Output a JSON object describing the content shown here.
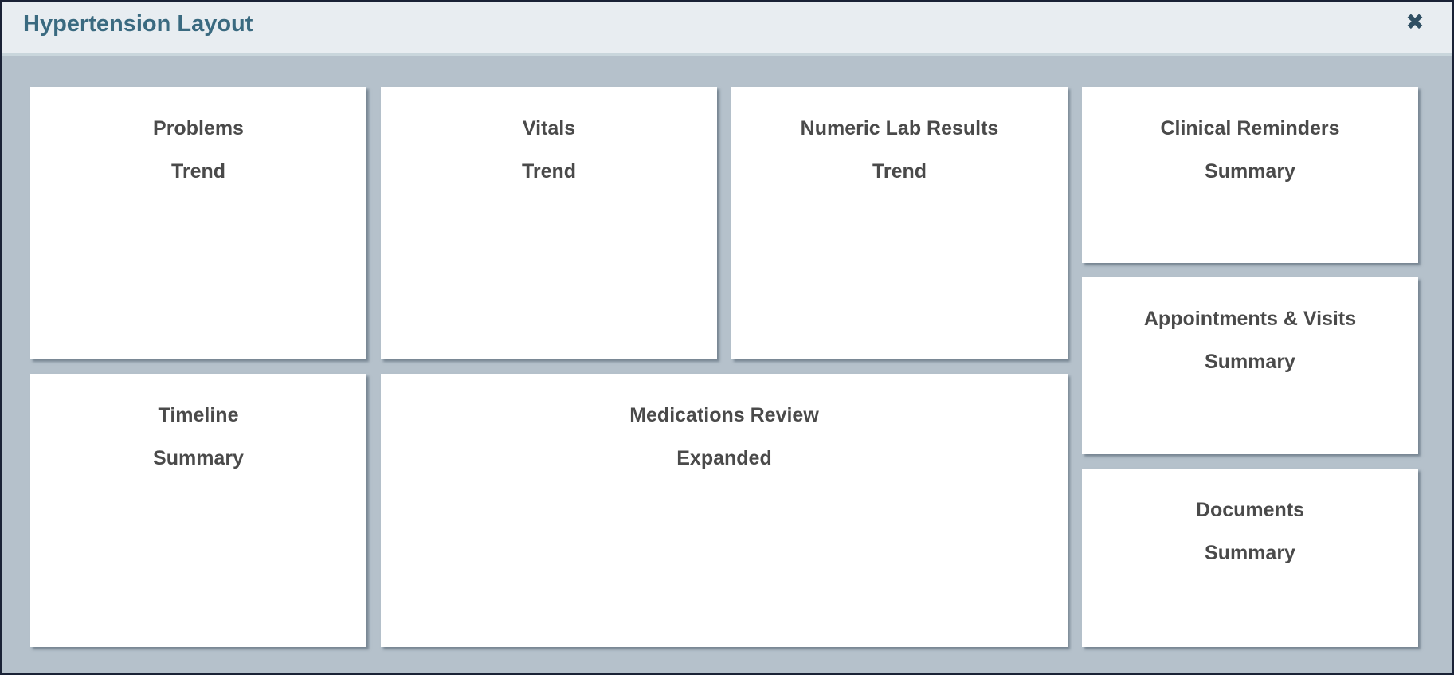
{
  "dialog": {
    "title": "Hypertension Layout",
    "close_glyph": "✖"
  },
  "tiles": [
    {
      "name": "Problems",
      "mode": "Trend"
    },
    {
      "name": "Vitals",
      "mode": "Trend"
    },
    {
      "name": "Numeric Lab Results",
      "mode": "Trend"
    },
    {
      "name": "Clinical Reminders",
      "mode": "Summary"
    },
    {
      "name": "Appointments & Visits",
      "mode": "Summary"
    },
    {
      "name": "Timeline",
      "mode": "Summary"
    },
    {
      "name": "Medications Review",
      "mode": "Expanded"
    },
    {
      "name": "Documents",
      "mode": "Summary"
    }
  ]
}
